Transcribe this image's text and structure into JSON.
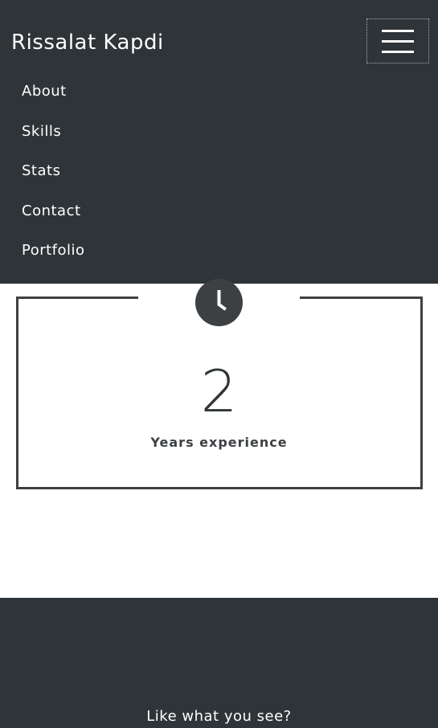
{
  "header": {
    "brand": "Rissalat Kapdi",
    "menu_toggle_icon": "hamburger-icon",
    "background_color": "#2e3437"
  },
  "nav": {
    "items": [
      {
        "label": "About"
      },
      {
        "label": "Skills"
      },
      {
        "label": "Stats"
      },
      {
        "label": "Contact"
      },
      {
        "label": "Portfolio"
      }
    ]
  },
  "stats": {
    "icon": "clock-icon",
    "value": "2",
    "label": "Years experience",
    "accent_color": "#3d4043"
  },
  "cta": {
    "text": "Like what you see?"
  }
}
